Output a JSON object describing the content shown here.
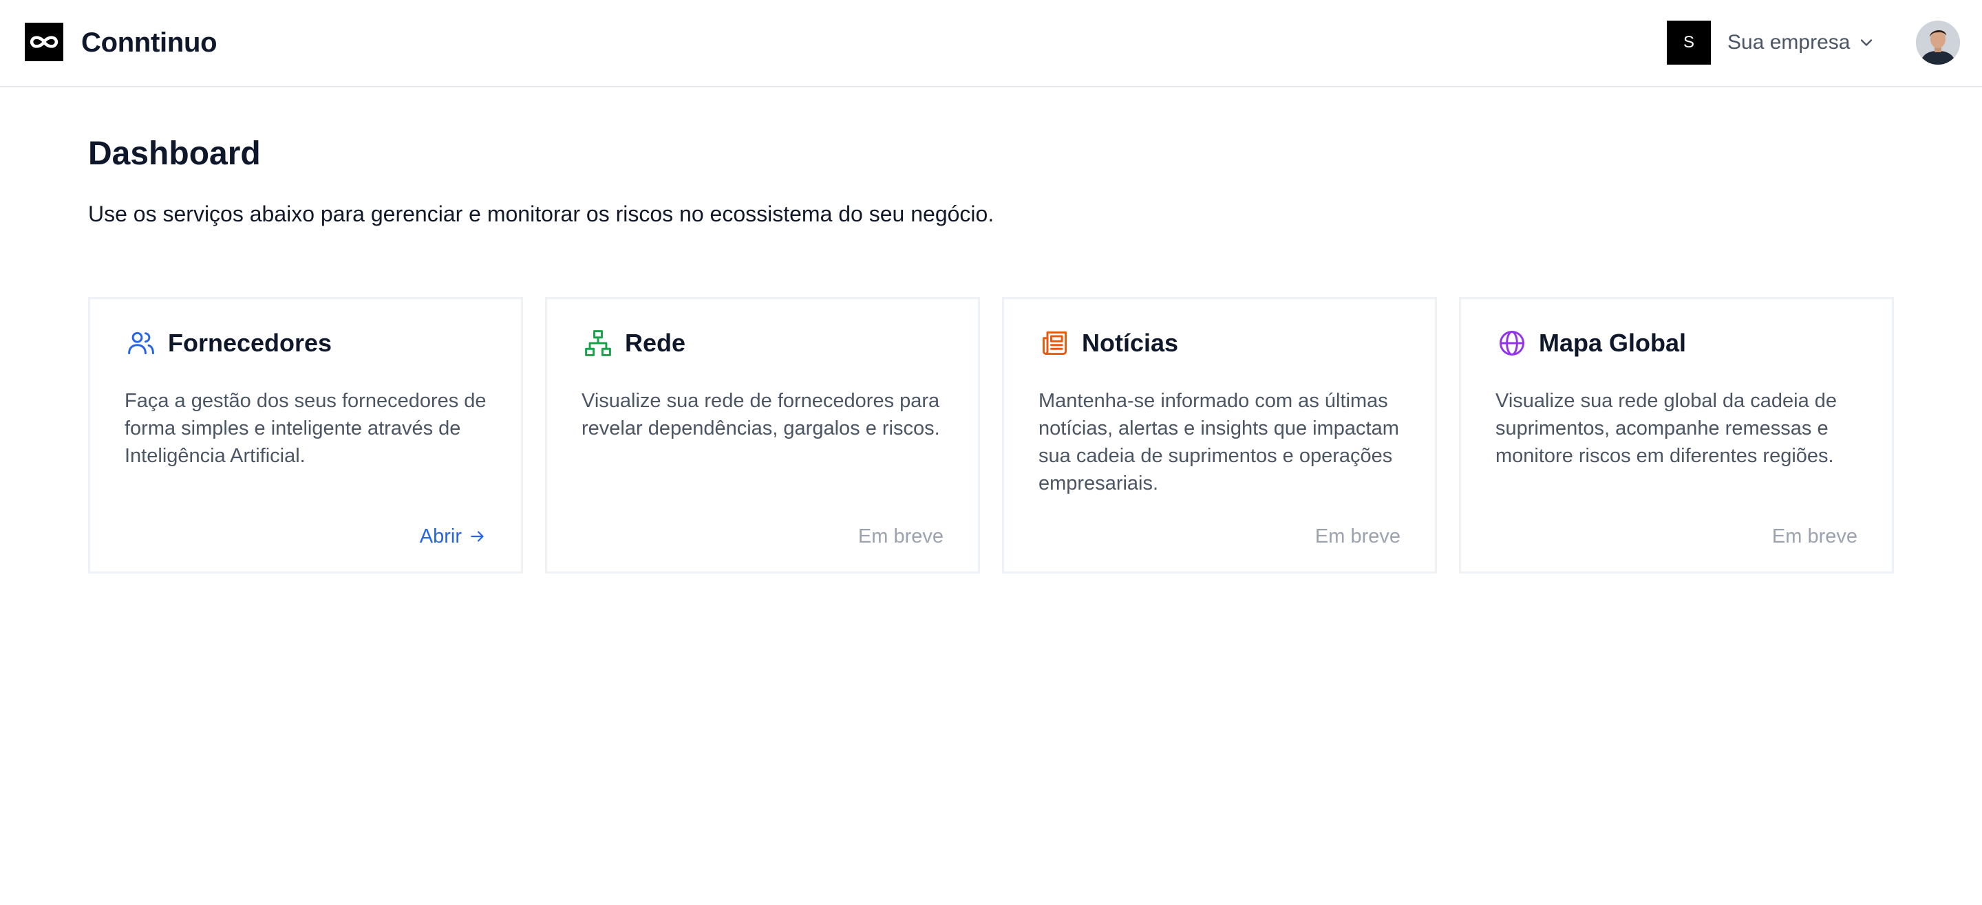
{
  "header": {
    "brand": "Conntinuo",
    "company_initial": "S",
    "company_name": "Sua empresa"
  },
  "page": {
    "title": "Dashboard",
    "subtitle": "Use os serviços abaixo para gerenciar e monitorar os riscos no ecossistema do seu negócio."
  },
  "cards": [
    {
      "title": "Fornecedores",
      "icon": "users-icon",
      "icon_color": "#2563eb",
      "description": "Faça a gestão dos seus fornecedores de forma simples e inteligente através de Inteligência Artificial.",
      "action": "Abrir"
    },
    {
      "title": "Rede",
      "icon": "network-icon",
      "icon_color": "#16a34a",
      "description": "Visualize sua rede de fornecedores para revelar dependências, gargalos e riscos.",
      "action": "Em breve"
    },
    {
      "title": "Notícias",
      "icon": "newspaper-icon",
      "icon_color": "#ea580c",
      "description": "Mantenha-se informado com as últimas notícias, alertas e insights que impactam sua cadeia de suprimentos e operações empresariais.",
      "action": "Em breve"
    },
    {
      "title": "Mapa Global",
      "icon": "globe-icon",
      "icon_color": "#9333ea",
      "description": "Visualize sua rede global da cadeia de suprimentos, acompanhe remessas e monitore riscos em diferentes regiões.",
      "action": "Em breve"
    }
  ]
}
